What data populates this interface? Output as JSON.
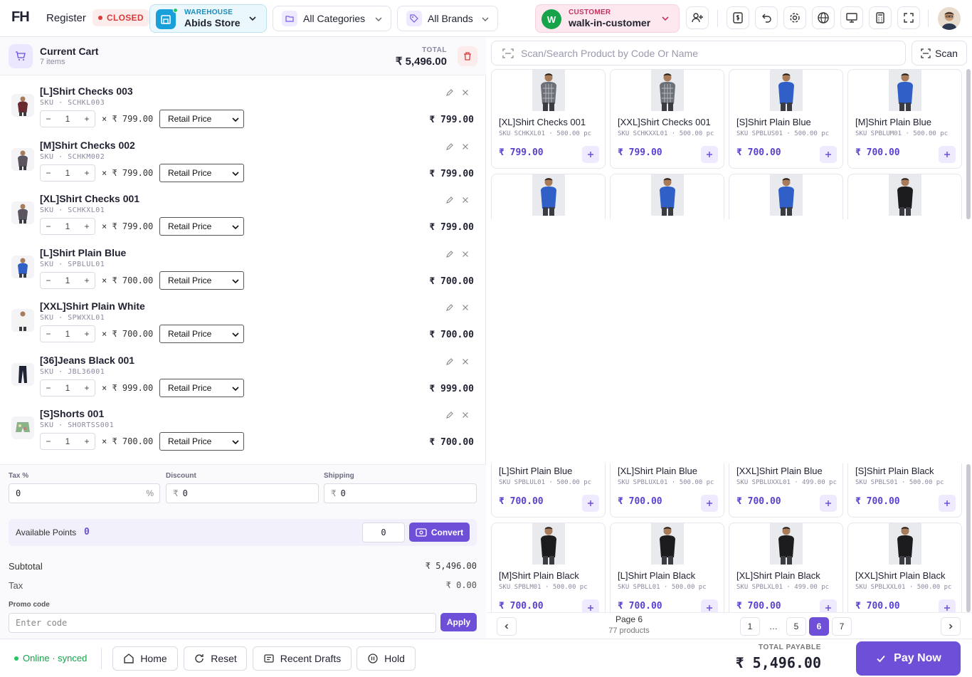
{
  "topbar": {
    "logo": "FH",
    "register_label": "Register",
    "register_status": "CLOSED",
    "warehouse": {
      "label": "WAREHOUSE",
      "value": "Abids Store"
    },
    "category_select": "All Categories",
    "brand_select": "All Brands",
    "customer": {
      "label": "CUSTOMER",
      "value": "walk-in-customer",
      "initial": "W"
    }
  },
  "cart": {
    "title": "Current Cart",
    "count": "7 items",
    "total_label": "TOTAL",
    "total_value": "₹ 5,496.00",
    "price_type_default": "Retail Price",
    "items": [
      {
        "name": "[L]Shirt Checks 003",
        "sku": "SKU · SCHKL003",
        "qty": "1",
        "unit": "× ₹ 799.00",
        "price_type": "Retail Price",
        "line_total": "₹ 799.00"
      },
      {
        "name": "[M]Shirt Checks 002",
        "sku": "SKU · SCHKM002",
        "qty": "1",
        "unit": "× ₹ 799.00",
        "price_type": "Retail Price",
        "line_total": "₹ 799.00"
      },
      {
        "name": "[XL]Shirt Checks 001",
        "sku": "SKU · SCHKXL01",
        "qty": "1",
        "unit": "× ₹ 799.00",
        "price_type": "Retail Price",
        "line_total": "₹ 799.00"
      },
      {
        "name": "[L]Shirt Plain Blue",
        "sku": "SKU · SPBLUL01",
        "qty": "1",
        "unit": "× ₹ 700.00",
        "price_type": "Retail Price",
        "line_total": "₹ 700.00"
      },
      {
        "name": "[XXL]Shirt Plain White",
        "sku": "SKU · SPWXXL01",
        "qty": "1",
        "unit": "× ₹ 700.00",
        "price_type": "Retail Price",
        "line_total": "₹ 700.00"
      },
      {
        "name": "[36]Jeans Black 001",
        "sku": "SKU · JBL36001",
        "qty": "1",
        "unit": "× ₹ 999.00",
        "price_type": "Retail Price",
        "line_total": "₹ 999.00"
      },
      {
        "name": "[S]Shorts 001",
        "sku": "SKU · SHORTSS001",
        "qty": "1",
        "unit": "× ₹ 700.00",
        "price_type": "Retail Price",
        "line_total": "₹ 700.00"
      }
    ]
  },
  "adjust": {
    "tax_label": "Tax %",
    "tax_value": "0",
    "tax_suffix": "%",
    "discount_label": "Discount",
    "discount_value": "0",
    "discount_prefix": "₹",
    "shipping_label": "Shipping",
    "shipping_value": "0",
    "shipping_prefix": "₹"
  },
  "points": {
    "label": "Available Points",
    "value": "0",
    "input_value": "0",
    "convert_label": "Convert"
  },
  "summary": {
    "subtotal_label": "Subtotal",
    "subtotal_value": "₹ 5,496.00",
    "tax_label": "Tax",
    "tax_value": "₹ 0.00",
    "promo_label": "Promo code",
    "promo_placeholder": "Enter code",
    "apply_label": "Apply"
  },
  "search": {
    "placeholder": "Scan/Search Product by Code Or Name",
    "scan_label": "Scan"
  },
  "products_top": [
    {
      "name": "[XL]Shirt Checks 001",
      "meta": "SKU SCHKXL01 · 500.00 pc",
      "price": "₹ 799.00",
      "img": "checks"
    },
    {
      "name": "[XXL]Shirt Checks 001",
      "meta": "SKU SCHKXXL01 · 500.00 pc",
      "price": "₹ 799.00",
      "img": "checks"
    },
    {
      "name": "[S]Shirt Plain Blue",
      "meta": "SKU SPBLUS01 · 500.00 pc",
      "price": "₹ 700.00",
      "img": "blue"
    },
    {
      "name": "[M]Shirt Plain Blue",
      "meta": "SKU SPBLUM01 · 500.00 pc",
      "price": "₹ 700.00",
      "img": "blue"
    }
  ],
  "products_row2_imgs": [
    "blue",
    "blue",
    "blue",
    "black"
  ],
  "products_bottom": [
    {
      "name": "[L]Shirt Plain Blue",
      "meta": "SKU SPBLUL01 · 500.00 pc",
      "price": "₹ 700.00",
      "img": "blue"
    },
    {
      "name": "[XL]Shirt Plain Blue",
      "meta": "SKU SPBLUXL01 · 500.00 pc",
      "price": "₹ 700.00",
      "img": "blue"
    },
    {
      "name": "[XXL]Shirt Plain Blue",
      "meta": "SKU SPBLUXXL01 · 499.00 pc",
      "price": "₹ 700.00",
      "img": "blue"
    },
    {
      "name": "[S]Shirt Plain Black",
      "meta": "SKU SPBLS01 · 500.00 pc",
      "price": "₹ 700.00",
      "img": "black"
    },
    {
      "name": "[M]Shirt Plain Black",
      "meta": "SKU SPBLM01 · 500.00 pc",
      "price": "₹ 700.00",
      "img": "black"
    },
    {
      "name": "[L]Shirt Plain Black",
      "meta": "SKU SPBLL01 · 500.00 pc",
      "price": "₹ 700.00",
      "img": "black"
    },
    {
      "name": "[XL]Shirt Plain Black",
      "meta": "SKU SPBLXL01 · 499.00 pc",
      "price": "₹ 700.00",
      "img": "black"
    },
    {
      "name": "[XXL]Shirt Plain Black",
      "meta": "SKU SPBLXXL01 · 500.00 pc",
      "price": "₹ 700.00",
      "img": "black"
    }
  ],
  "pagination": {
    "page_label": "Page 6",
    "count_label": "77 products",
    "pages": [
      "1",
      "…",
      "5",
      "6",
      "7"
    ],
    "active": "6"
  },
  "bottom": {
    "status": "Online · synced",
    "home_label": "Home",
    "reset_label": "Reset",
    "drafts_label": "Recent Drafts",
    "hold_label": "Hold",
    "total_payable_label": "TOTAL PAYABLE",
    "total_payable_value": "₹ 5,496.00",
    "pay_label": "Pay Now"
  },
  "colors": {
    "accent": "#6d4fd8",
    "danger": "#d93b3b",
    "online": "#22c55e"
  }
}
